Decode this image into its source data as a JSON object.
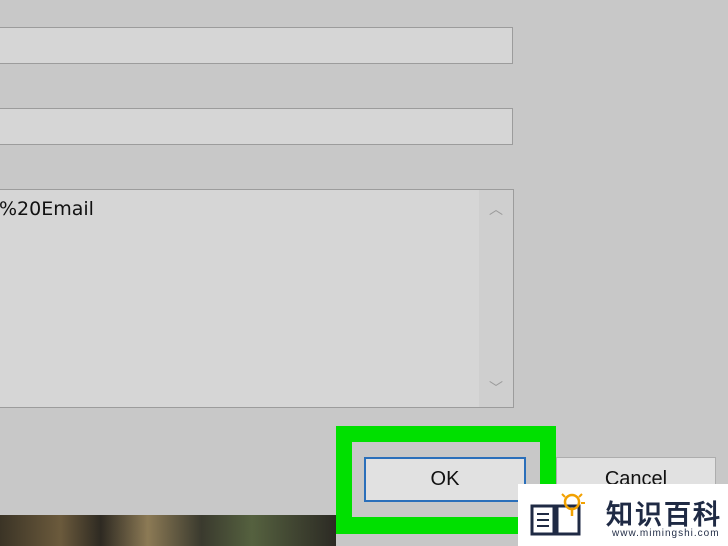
{
  "form": {
    "field1_value": "",
    "field2_value": "",
    "body_text": "%20Email"
  },
  "buttons": {
    "ok_label": "OK",
    "cancel_label": "Cancel"
  },
  "scrollbar": {
    "up_glyph": "︿",
    "down_glyph": "﹀"
  },
  "colors": {
    "highlight": "#00e000",
    "focus_border": "#2a6fba"
  },
  "watermark": {
    "title": "知识百科",
    "url": "www.mimingshi.com"
  }
}
